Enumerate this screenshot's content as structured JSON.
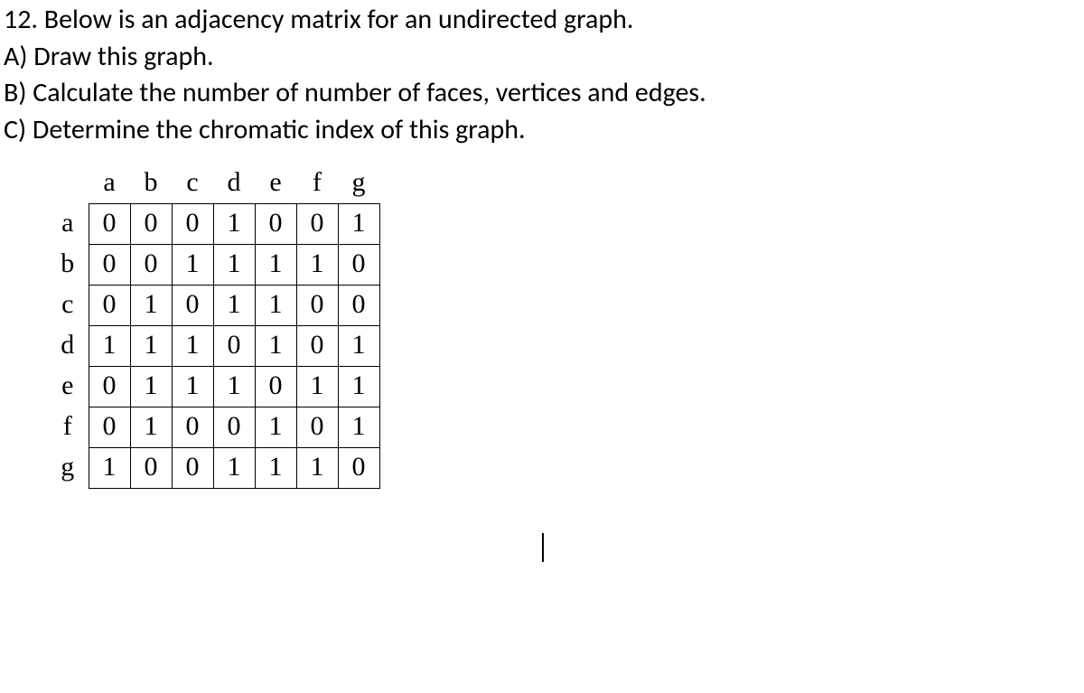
{
  "question": {
    "number_line": "12. Below is an adjacency matrix for an undirected graph.",
    "part_a": "A) Draw this graph.",
    "part_b": "B) Calculate the number of number of faces, vertices and edges.",
    "part_c": "C) Determine the chromatic index of this graph."
  },
  "chart_data": {
    "type": "table",
    "title": "",
    "headers": [
      "a",
      "b",
      "c",
      "d",
      "e",
      "f",
      "g"
    ],
    "row_labels": [
      "a",
      "b",
      "c",
      "d",
      "e",
      "f",
      "g"
    ],
    "rows": [
      [
        "0",
        "0",
        "0",
        "1",
        "0",
        "0",
        "1"
      ],
      [
        "0",
        "0",
        "1",
        "1",
        "1",
        "1",
        "0"
      ],
      [
        "0",
        "1",
        "0",
        "1",
        "1",
        "0",
        "0"
      ],
      [
        "1",
        "1",
        "1",
        "0",
        "1",
        "0",
        "1"
      ],
      [
        "0",
        "1",
        "1",
        "1",
        "0",
        "1",
        "1"
      ],
      [
        "0",
        "1",
        "0",
        "0",
        "1",
        "0",
        "1"
      ],
      [
        "1",
        "0",
        "0",
        "1",
        "1",
        "1",
        "0"
      ]
    ]
  }
}
